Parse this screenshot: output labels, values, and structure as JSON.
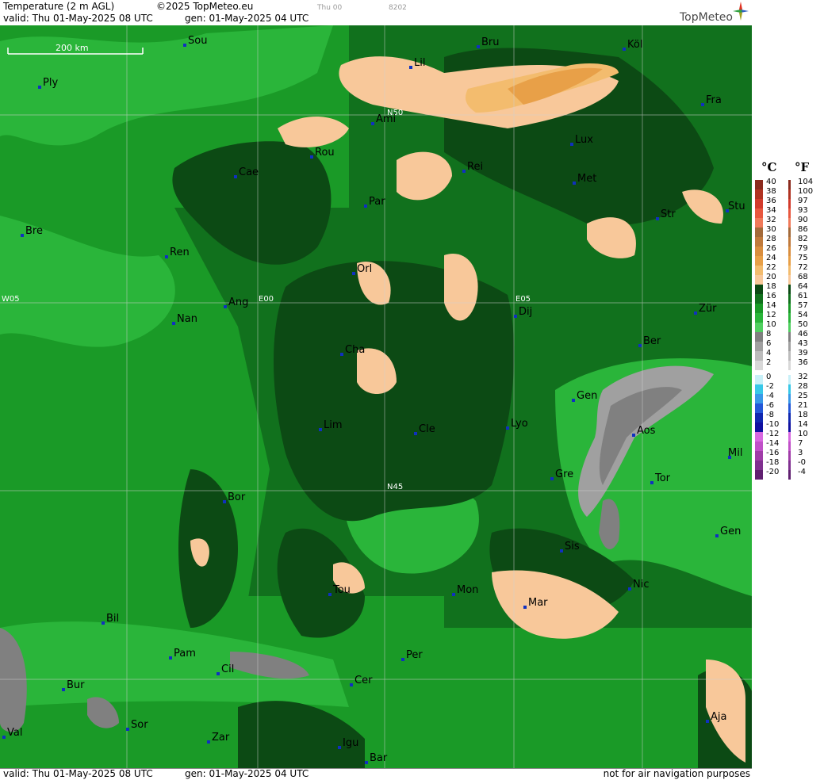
{
  "header": {
    "title": "Temperature (2 m AGL)",
    "copyright": "©2025 TopMeteo.eu",
    "day_code": "Thu 00",
    "run_code": "8202",
    "valid": "valid:  Thu  01-May-2025  08 UTC",
    "generated": "gen: 01-May-2025 04 UTC",
    "logo": "TopMeteo"
  },
  "footer": {
    "valid": "valid:  Thu  01-May-2025  08 UTC",
    "generated": "gen: 01-May-2025 04 UTC",
    "disclaimer": "not for air navigation purposes"
  },
  "map": {
    "scale_label": "200 km",
    "grid_labels": [
      "N50",
      "N45",
      "W05",
      "E00",
      "E05"
    ],
    "cities": [
      "Sou",
      "Ply",
      "Lil",
      "Bru",
      "Köl",
      "Ami",
      "Fra",
      "Rou",
      "Lux",
      "Cae",
      "Rei",
      "Met",
      "Bre",
      "Par",
      "Str",
      "Stu",
      "Ren",
      "Orl",
      "Ang",
      "Dij",
      "Zür",
      "Nan",
      "Ber",
      "Cha",
      "Gen",
      "Lim",
      "Cle",
      "Lyo",
      "Aos",
      "Mil",
      "Gre",
      "Tor",
      "Bor",
      "Sis",
      "Gen",
      "Tou",
      "Mon",
      "Mar",
      "Nic",
      "Bil",
      "Pam",
      "Cil",
      "Per",
      "Cer",
      "Bur",
      "Sor",
      "Aja",
      "Val",
      "Zar",
      "Igu",
      "Bar"
    ]
  },
  "legend": {
    "unit_c": "°C",
    "unit_f": "°F",
    "celsius": [
      "40",
      "38",
      "36",
      "34",
      "32",
      "30",
      "28",
      "26",
      "24",
      "22",
      "20",
      "18",
      "16",
      "14",
      "12",
      "10",
      "8",
      "6",
      "4",
      "2",
      "0",
      "-2",
      "-4",
      "-6",
      "-8",
      "-10",
      "-12",
      "-14",
      "-16",
      "-18",
      "-20"
    ],
    "fahrenheit": [
      "104",
      "100",
      "97",
      "93",
      "90",
      "86",
      "82",
      "79",
      "75",
      "72",
      "68",
      "64",
      "61",
      "57",
      "54",
      "50",
      "46",
      "43",
      "39",
      "36",
      "32",
      "28",
      "25",
      "21",
      "18",
      "14",
      "10",
      "7",
      "3",
      "-0",
      "-4"
    ],
    "colors": [
      "#8b2b1e",
      "#b03322",
      "#d23b2c",
      "#e8583f",
      "#f07a5a",
      "#a36a3a",
      "#c07a3c",
      "#d98e3f",
      "#e8a048",
      "#f3bc6e",
      "#f8c89a",
      "#0c4a14",
      "#11711d",
      "#1a9a27",
      "#2ab53a",
      "#50d060",
      "#808080",
      "#a0a0a0",
      "#bcbcbc",
      "#d8d8d8",
      "#c8f0f8",
      "#38c8e8",
      "#3898e8",
      "#2458d8",
      "#1028b0",
      "#1010a0",
      "#d868e0",
      "#c050c8",
      "#a03ca8",
      "#803090",
      "#602070"
    ]
  }
}
